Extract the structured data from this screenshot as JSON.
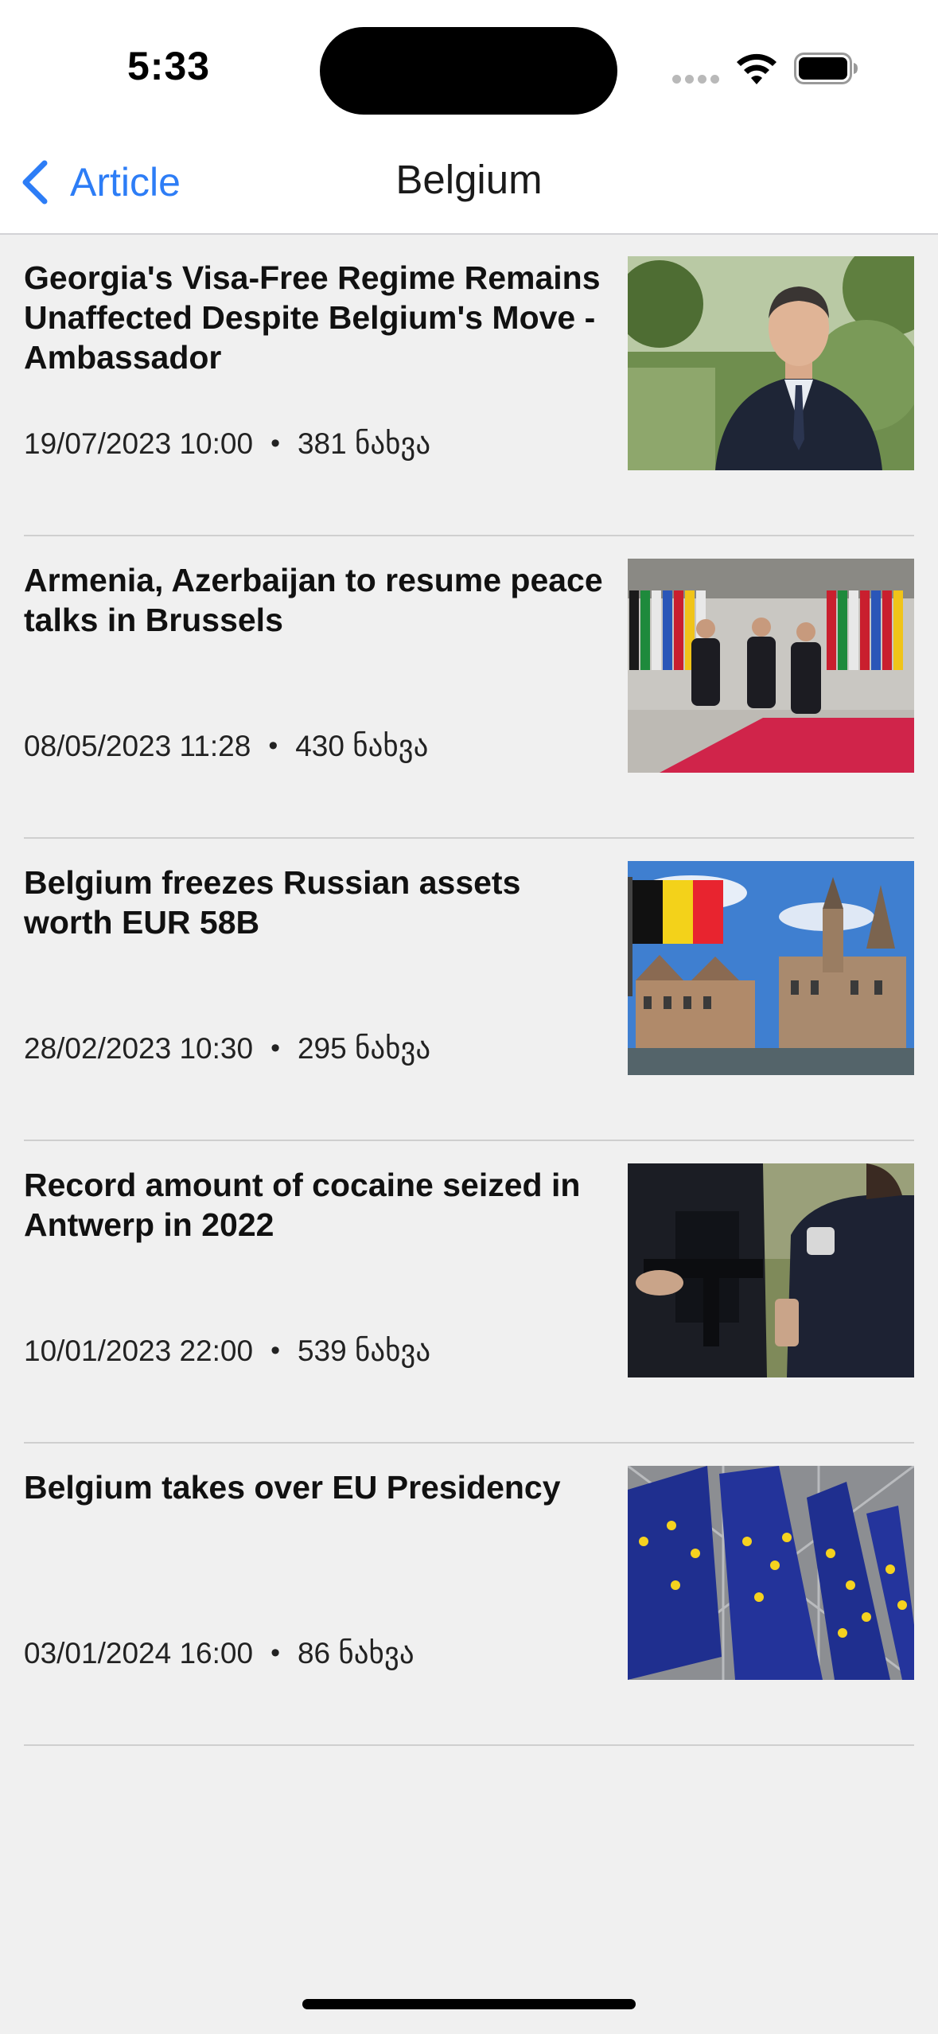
{
  "status_bar": {
    "time": "5:33"
  },
  "nav": {
    "back_label": "Article",
    "title": "Belgium"
  },
  "colors": {
    "accent": "#2d7df6",
    "background": "#f0f0f0"
  },
  "articles": [
    {
      "title": "Georgia's Visa-Free Regime Remains Unaffected Despite Belgium's Move - Ambassador",
      "date": "19/07/2023 10:00",
      "views": "381 ნახვა",
      "image": "man-in-suit-photo"
    },
    {
      "title": " Armenia, Azerbaijan to resume peace talks in Brussels",
      "date": "08/05/2023 11:28",
      "views": "430 ნახვა",
      "image": "leaders-walking-flags-photo"
    },
    {
      "title": "Belgium freezes Russian assets worth EUR 58B",
      "date": "28/02/2023 10:30",
      "views": "295 ნახვა",
      "image": "belgian-flag-city-photo"
    },
    {
      "title": "Record amount of cocaine seized in Antwerp in 2022",
      "date": "10/01/2023 22:00",
      "views": "539 ნახვა",
      "image": "police-officers-photo"
    },
    {
      "title": "Belgium takes over EU Presidency",
      "date": "03/01/2024 16:00",
      "views": "86 ნახვა",
      "image": "eu-flags-photo"
    }
  ]
}
